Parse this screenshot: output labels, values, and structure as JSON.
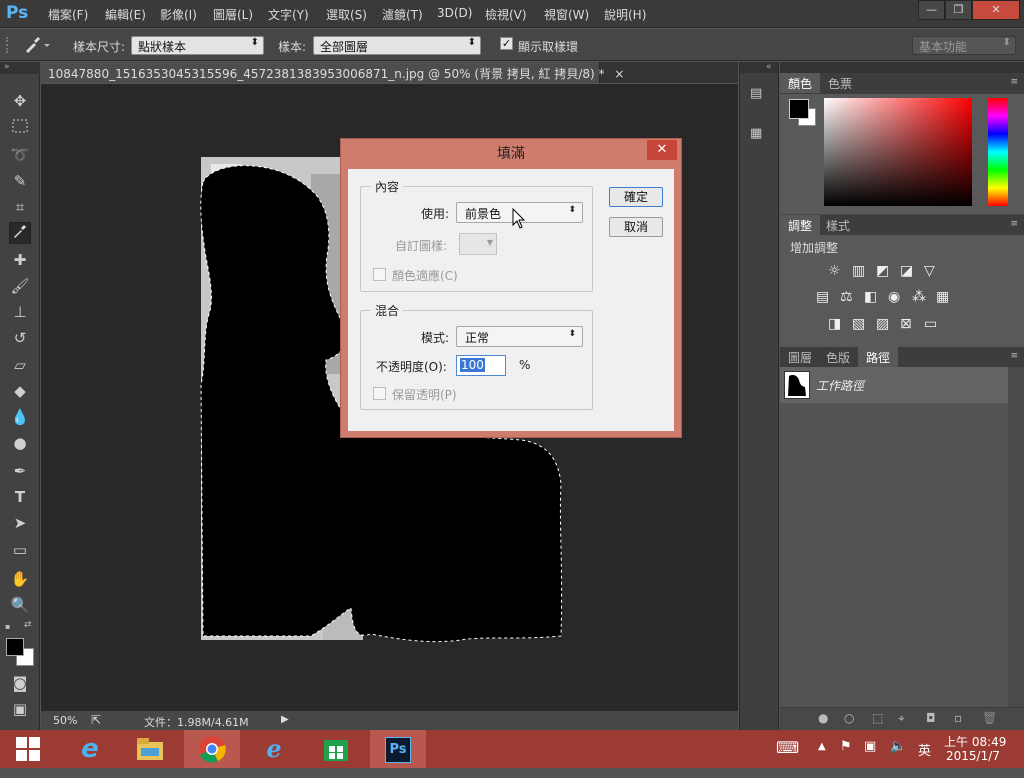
{
  "app": {
    "logo": "Ps"
  },
  "menu": [
    "檔案(F)",
    "編輯(E)",
    "影像(I)",
    "圖層(L)",
    "文字(Y)",
    "選取(S)",
    "濾鏡(T)",
    "3D(D)",
    "檢視(V)",
    "視窗(W)",
    "說明(H)"
  ],
  "window_controls": {
    "minimize": "—",
    "restore": "❐",
    "close": "✕"
  },
  "options": {
    "sample_size_label": "樣本尺寸:",
    "sample_size_value": "點狀樣本",
    "sample_label": "樣本:",
    "sample_value": "全部圖層",
    "show_ring_label": "顯示取樣環",
    "workspace": "基本功能"
  },
  "document": {
    "tab_title": "10847880_1516353045315596_4572381383953006871_n.jpg @ 50% (背景 拷貝, 紅 拷貝/8) *",
    "close": "×"
  },
  "status": {
    "zoom": "50%",
    "file_info": "文件：1.98M/4.61M"
  },
  "panels": {
    "color_tabs": [
      "顏色",
      "色票"
    ],
    "adjust_tabs": [
      "調整",
      "樣式"
    ],
    "adjust_title": "增加調整",
    "layer_tabs": [
      "圖層",
      "色版",
      "路徑"
    ],
    "path_item": "工作路徑"
  },
  "dialog": {
    "title": "填滿",
    "close": "✕",
    "contents_group": "內容",
    "use_label": "使用:",
    "use_value": "前景色",
    "custom_pattern_label": "自訂圖樣:",
    "color_adapt_label": "顏色適應(C)",
    "blend_group": "混合",
    "mode_label": "模式:",
    "mode_value": "正常",
    "opacity_label": "不透明度(O):",
    "opacity_value": "100",
    "opacity_unit": "%",
    "preserve_label": "保留透明(P)",
    "ok": "確定",
    "cancel": "取消"
  },
  "taskbar": {
    "ime": "英",
    "time": "上午 08:49",
    "date": "2015/1/7"
  },
  "colors": {
    "foreground": "#000000",
    "background": "#ffffff",
    "dialog_frame": "#cf7c6c",
    "taskbar": "#9c3b33",
    "accent": "#5cb4f5"
  }
}
